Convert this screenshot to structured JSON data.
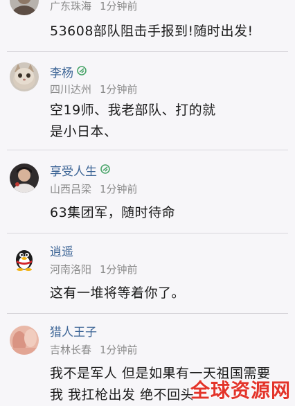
{
  "comments": [
    {
      "name": "",
      "location": "广东珠海",
      "time": "1分钟前",
      "text": "53608部队阻击手报到!随时出发!",
      "avatar_icon": "user-avatar-icon",
      "verified": false
    },
    {
      "name": "李杨",
      "location": "四川达州",
      "time": "1分钟前",
      "text": "空19师、我老部队、打的就是小日本、",
      "avatar_icon": "cat-avatar-icon",
      "verified": true
    },
    {
      "name": "享受人生",
      "location": "山西吕梁",
      "time": "1分钟前",
      "text": "63集团军，随时待命",
      "avatar_icon": "person-avatar-icon",
      "verified": true
    },
    {
      "name": "逍遥",
      "location": "河南洛阳",
      "time": "1分钟前",
      "text": "这有一堆将等着你了。",
      "avatar_icon": "qq-penguin-icon",
      "verified": false
    },
    {
      "name": "猎人王子",
      "location": "吉林长春",
      "time": "1分钟前",
      "text": "我不是军人 但是如果有一天祖国需要我 我扛枪出发 绝不回头",
      "avatar_icon": "photo-avatar-icon",
      "verified": false
    }
  ],
  "watermark": "全球资源网",
  "colors": {
    "name": "#3d6596",
    "meta": "#8a8a8a",
    "verified_badge": "#4aa56a",
    "watermark": "#e3342a",
    "background": "#f7f6f9"
  }
}
